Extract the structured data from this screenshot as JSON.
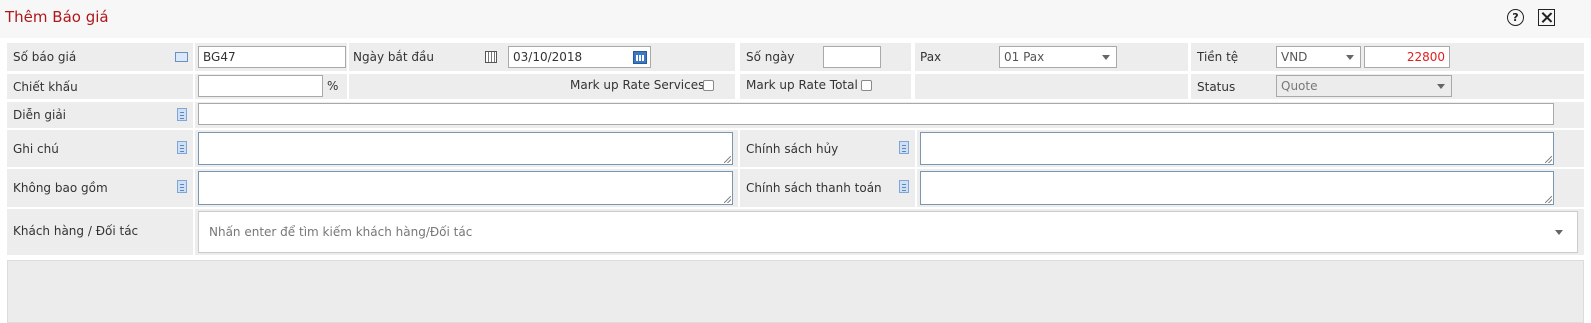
{
  "window": {
    "title": "Thêm Báo giá"
  },
  "fields": {
    "so_bao_gia": {
      "label": "Số báo giá",
      "value": "BG47"
    },
    "ngay_bat_dau": {
      "label": "Ngày bắt đầu",
      "value": "03/10/2018"
    },
    "so_ngay": {
      "label": "Số ngày",
      "value": ""
    },
    "pax": {
      "label": "Pax",
      "selected": "01 Pax"
    },
    "tien_te": {
      "label": "Tiền tệ",
      "selected": "VND",
      "rate": "22800"
    },
    "chiet_khau": {
      "label": "Chiết khấu",
      "value": "",
      "unit": "%"
    },
    "markup_services": {
      "label": "Mark up Rate Services",
      "checked": false
    },
    "markup_total": {
      "label": "Mark up Rate Total",
      "checked": false
    },
    "status": {
      "label": "Status",
      "selected": "Quote"
    },
    "dien_giai": {
      "label": "Diễn giải",
      "value": ""
    },
    "ghi_chu": {
      "label": "Ghi chú",
      "value": ""
    },
    "chinh_sach_huy": {
      "label": "Chính sách hủy",
      "value": ""
    },
    "khong_bao_gom": {
      "label": "Không bao gồm",
      "value": ""
    },
    "chinh_sach_thanh_toan": {
      "label": "Chính sách thanh toán",
      "value": ""
    },
    "khach_hang": {
      "label": "Khách hàng / Đối tác",
      "placeholder": "Nhấn enter để tìm kiếm khách hàng/Đối tác"
    }
  },
  "icons": {
    "help": "help-icon",
    "close": "close-icon",
    "note": "note-icon",
    "calendar": "calendar-icon"
  },
  "colors": {
    "title": "#b0171b",
    "rate_text": "#e02020",
    "calendar_button": "#3a78c4"
  }
}
